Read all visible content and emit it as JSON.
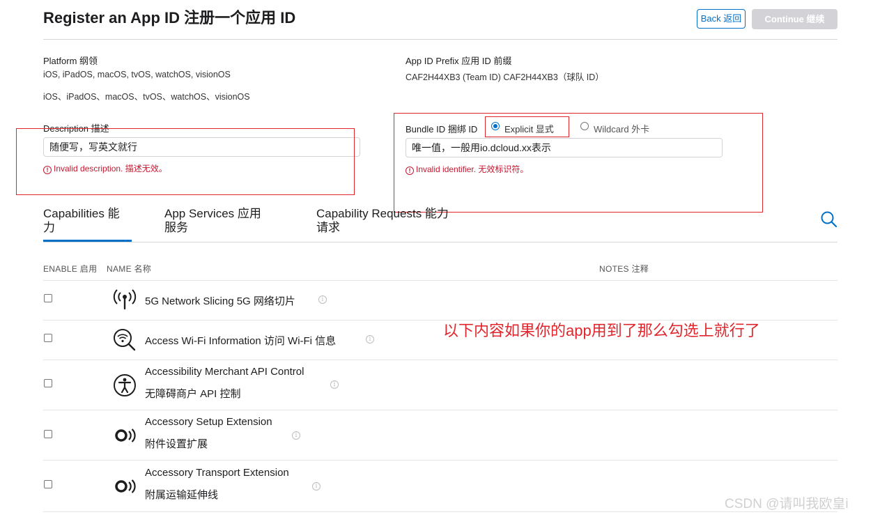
{
  "header": {
    "title": "Register an App ID  注册一个应用 ID",
    "back_label": "Back  返回",
    "continue_label": "Continue  继续"
  },
  "platform": {
    "label": "Platform  纲领",
    "value_en": "iOS, iPadOS, macOS, tvOS, watchOS, visionOS",
    "value_cn": "iOS、iPadOS、macOS、tvOS、watchOS、visionOS"
  },
  "prefix": {
    "label": "App ID Prefix  应用 ID 前缀",
    "value": "CAF2H44XB3 (Team ID)  CAF2H44XB3（球队 ID）"
  },
  "description": {
    "label": "Description  描述",
    "value": "随便写，写英文就行",
    "error": "Invalid description.  描述无效。"
  },
  "bundle": {
    "label": "Bundle ID  捆绑 ID",
    "explicit_label": "Explicit  显式",
    "wildcard_label": "Wildcard  外卡",
    "selected": "explicit",
    "value": "唯一值，一般用io.dcloud.xx表示",
    "error": "Invalid identifier.  无效标识符。"
  },
  "tabs": [
    {
      "line1": "Capabilities  能",
      "line2": "力"
    },
    {
      "line1": "App Services  应用",
      "line2": "服务"
    },
    {
      "line1": "Capability Requests  能力",
      "line2": "请求"
    }
  ],
  "table": {
    "col_enable": "ENABLE  启用",
    "col_name": "NAME  名称",
    "col_notes": "NOTES  注释",
    "rows": [
      {
        "name": "5G Network Slicing  5G 网络切片",
        "icon": "antenna-icon"
      },
      {
        "name": "Access Wi-Fi Information  访问 Wi-Fi 信息",
        "icon": "wifi-search-icon"
      },
      {
        "name": "Accessibility Merchant API Control",
        "name_cn": "无障碍商户 API 控制",
        "icon": "accessibility-icon"
      },
      {
        "name": "Accessory Setup Extension",
        "name_cn": "附件设置扩展",
        "icon": "accessory-icon"
      },
      {
        "name": "Accessory Transport Extension",
        "name_cn": "附属运输延伸线",
        "icon": "accessory-icon"
      }
    ]
  },
  "annotation": "以下内容如果你的app用到了那么勾选上就行了",
  "watermark": "CSDN @请叫我欧皇i",
  "colors": {
    "accent": "#0070c9",
    "error": "#c6162e",
    "annotation_red": "#e0262c"
  }
}
